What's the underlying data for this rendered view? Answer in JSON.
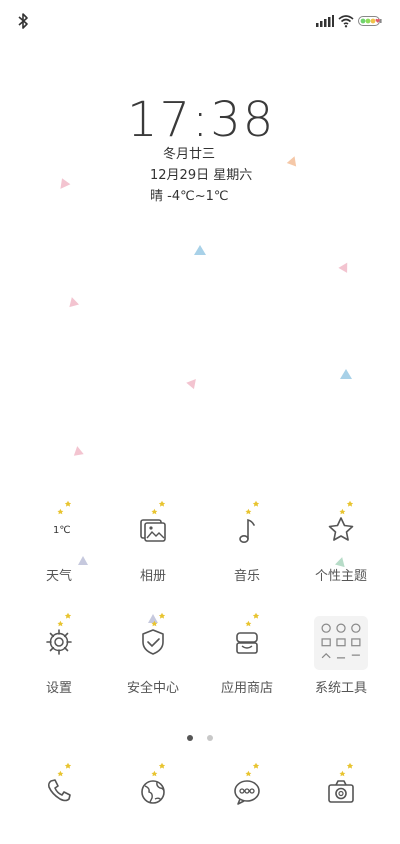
{
  "status": {
    "icons": [
      "bluetooth-icon",
      "signal-icon",
      "wifi-icon",
      "battery-icon"
    ],
    "battery_color": "#6fd36f"
  },
  "widget": {
    "time": "17:38",
    "lunar_date": "冬月廿三",
    "date": "12月29日 星期六",
    "weather": "晴 -4℃~1℃"
  },
  "apps_row1": [
    {
      "label": "天气",
      "icon": "weather-icon",
      "text": "1℃"
    },
    {
      "label": "相册",
      "icon": "gallery-icon"
    },
    {
      "label": "音乐",
      "icon": "music-note-icon"
    },
    {
      "label": "个性主题",
      "icon": "star-icon"
    }
  ],
  "apps_row2": [
    {
      "label": "设置",
      "icon": "gear-icon"
    },
    {
      "label": "安全中心",
      "icon": "shield-check-icon"
    },
    {
      "label": "应用商店",
      "icon": "store-icon"
    },
    {
      "label": "系统工具",
      "icon": "folder-grid-icon"
    }
  ],
  "dock": [
    {
      "icon": "phone-icon"
    },
    {
      "icon": "browser-globe-icon"
    },
    {
      "icon": "message-bubble-icon"
    },
    {
      "icon": "camera-icon"
    }
  ],
  "pages": {
    "count": 2,
    "active": 1
  },
  "colors": {
    "spark": "#e8c430",
    "accent_blue": "#9cc9e2",
    "accent_pink": "#f3b8c6"
  }
}
